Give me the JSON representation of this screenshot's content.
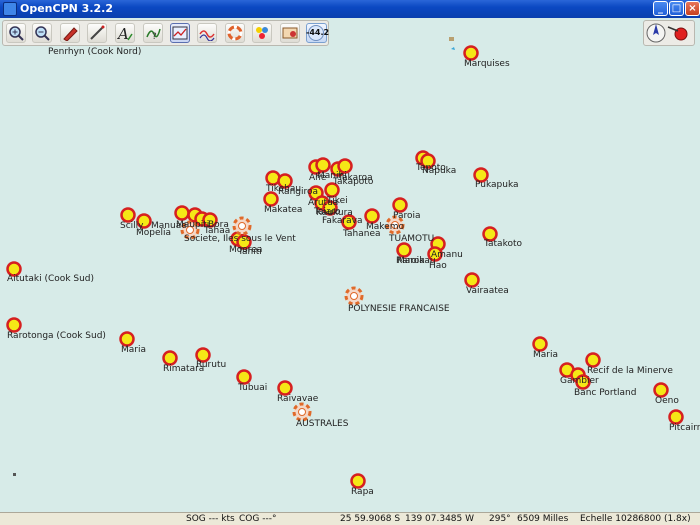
{
  "window": {
    "title": "OpenCPN 3.2.2",
    "buttons": [
      "_",
      "□",
      "×"
    ]
  },
  "toolbar": {
    "tools": [
      "zoom-in",
      "zoom-out",
      "route",
      "measure",
      "text",
      "tracks",
      "chart-quilt",
      "tides",
      "lifebuoy",
      "ais",
      "layers",
      "settings"
    ],
    "zoom_value": "-44.2"
  },
  "compass": {
    "icons": [
      "north-up-arrow",
      "gps-status"
    ]
  },
  "labels": {
    "penrhyn": "Penrhyn (Cook Nord)",
    "marquises": "Marquises",
    "tepoto": "Tepoto",
    "napuka": "Napuka",
    "pukapuka": "Pukapuka",
    "tikehau": "Tikehau",
    "rangiroa": "Rangiroa",
    "manihi": "Manihi",
    "takaroa": "Takaroa",
    "ahe": "Ahe",
    "takapoto": "Takapoto",
    "makatea": "Makatea",
    "arutua": "Arutua",
    "kaukura": "Kaukura",
    "tikei": "Tikei",
    "taiaro": "Taiaro",
    "fakarava": "Fakarava",
    "paroia": "Paroia",
    "makemo": "Makemo",
    "tahanea": "Tahanea",
    "tuamotu": "TUAMOTU",
    "raroia": "Raroia",
    "scilly": "Scilly",
    "manuae": "Manuae",
    "mopelia": "Mopelia",
    "maupiti": "Maupiti",
    "bora": "Bora",
    "societe": "Societe, Iles sous le Vent",
    "tahaa": "Tahaa",
    "moorea": "Moorea",
    "tahiti": "Tahiti",
    "amanu": "Amanu",
    "marokau": "Marokau",
    "hao": "Hao",
    "tatakoto": "Tatakoto",
    "aitutaki": "Aitutaki (Cook Sud)",
    "vairaatea": "Vairaatea",
    "polynesie": "POLYNESIE FRANCAISE",
    "rarotonga": "Rarotonga (Cook Sud)",
    "maria_w": "Maria",
    "rimatara": "Rimatara",
    "rurutu": "Rurutu",
    "tubuai": "Tubuai",
    "raivavae": "Raivavae",
    "australes": "AUSTRALES",
    "maria_e": "Maria",
    "minerve": "Recif de la Minerve",
    "gambier": "Gambier",
    "portland": "Banc Portland",
    "oeno": "Oeno",
    "pitcairn": "Pitcairn",
    "rapa": "Rapa"
  },
  "status": {
    "sog": "SOG --- kts",
    "cog": "COG ---°",
    "lat": "25 59.9068 S",
    "lon": "139 07.3485 W",
    "bearing": "295°",
    "distance": "6509 Milles",
    "scale": "Echelle 10286800 (1.8x)"
  },
  "colors": {
    "water": "#d7ebe8",
    "station_ring": "#d62020",
    "station_fill": "#f5e816",
    "titlebar": "#0b48c2"
  }
}
